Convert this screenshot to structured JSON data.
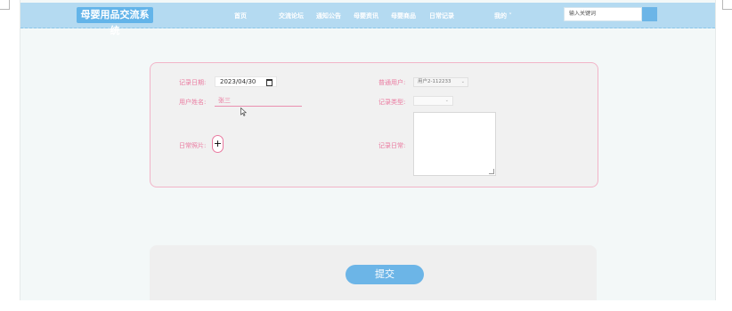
{
  "header": {
    "logo": "母婴用品交流系统",
    "nav": [
      {
        "label": "首页"
      },
      {
        "label": "交流论坛"
      },
      {
        "label": "通知公告"
      },
      {
        "label": "母婴资讯"
      },
      {
        "label": "母婴商品"
      },
      {
        "label": "日常记录"
      },
      {
        "label": "我的 ˅"
      }
    ],
    "search": {
      "placeholder": "输入关键词"
    }
  },
  "form": {
    "record_date": {
      "label": "记录日期:",
      "value": "2023/04/30"
    },
    "username": {
      "label": "用户姓名:",
      "value": "张三"
    },
    "photo": {
      "label": "日常照片:",
      "add_symbol": "+"
    },
    "user": {
      "label": "普通用户:",
      "value": "用户2-112233",
      "arrow": "⌄"
    },
    "record_type": {
      "label": "记录类型:",
      "value": "",
      "arrow": "⌄"
    },
    "record_diary": {
      "label": "记录日常:",
      "value": ""
    }
  },
  "submit": {
    "label": "提交"
  },
  "colors": {
    "header_bg": "#b4daf1",
    "accent_blue": "#6cb5e7",
    "label_pink": "#ea7aa0",
    "card_border": "#f2b4c8"
  }
}
